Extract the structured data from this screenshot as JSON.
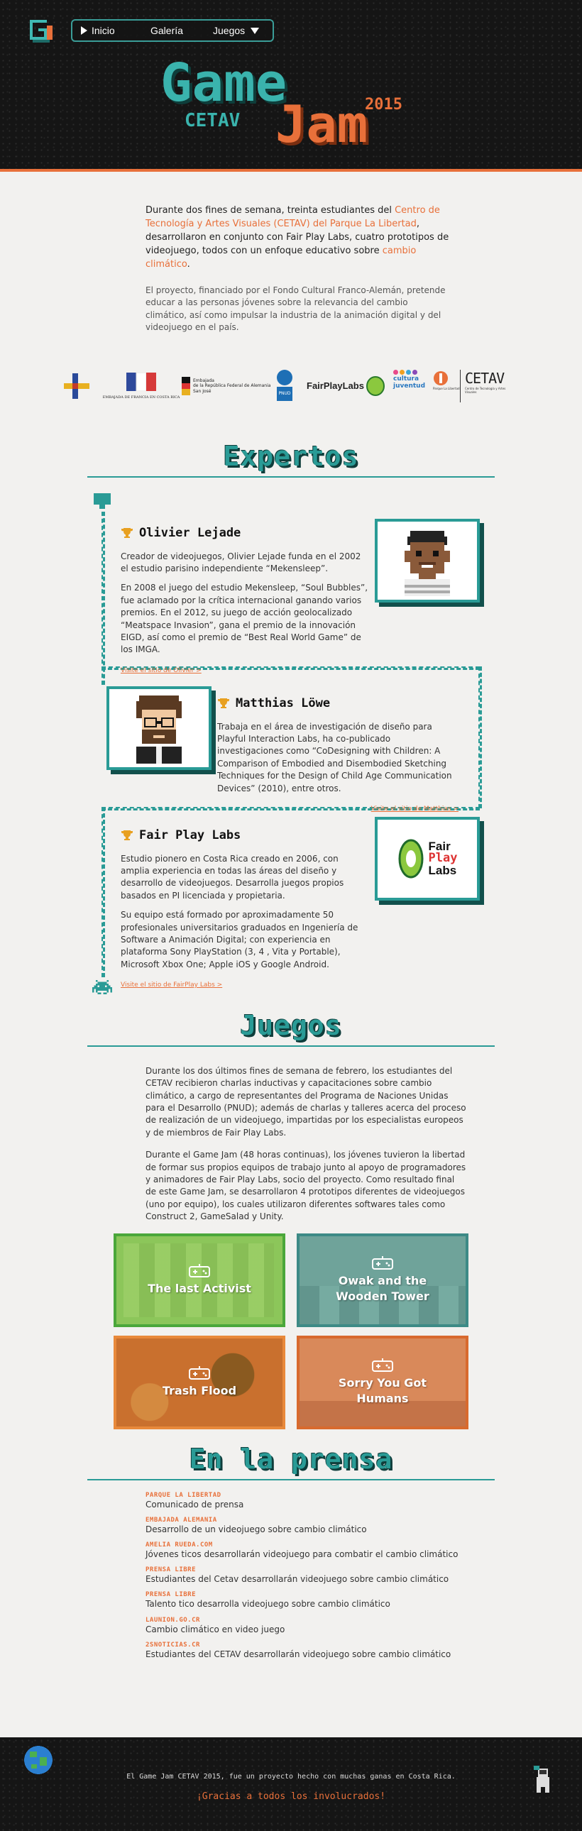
{
  "nav": {
    "items": [
      {
        "label": "Inicio",
        "icon": "play-arrow-icon"
      },
      {
        "label": "Galería"
      },
      {
        "label": "Juegos",
        "icon": "chevron-down-icon"
      }
    ]
  },
  "hero": {
    "word1": "Game",
    "word2": "CETAV",
    "word3": "Jam",
    "year": "2015"
  },
  "intro": {
    "lead_pre": "Durante dos fines de semana, treinta estudiantes del ",
    "lead_link1": "Centro de Tecnología y Artes Visuales (CETAV) del Parque La Libertad",
    "lead_mid": ", desarrollaron en conjunto con Fair Play Labs, cuatro prototipos de videojuego, todos con un enfoque educativo sobre ",
    "lead_link2": "cambio climático",
    "lead_end": ".",
    "body": "El proyecto, financiado por el Fondo Cultural Franco-Alemán, pretende educar a las personas jóvenes sobre la relevancia del cambio climático, así como impulsar la industria de la animación digital y del videojuego en el país."
  },
  "logos": {
    "france": "EMBAJADA DE FRANCIA EN COSTA RICA",
    "germany_1": "Embajada",
    "germany_2": "de la República Federal de Alemania",
    "germany_3": "San José",
    "undp": "PNUD",
    "fairplay": "FairPlayLabs",
    "cultura": "cultura juventud",
    "libertad": "Parque La Libertad",
    "cetav": "CETAV",
    "cetav_sub": "Centro de Tecnología y Artes Visuales"
  },
  "experts": {
    "title": "Expertos",
    "people": [
      {
        "name": "Olivier Lejade",
        "p1": "Creador de videojuegos, Olivier Lejade funda en el 2002 el estudio parisino independiente “Mekensleep”.",
        "p2": "En 2008 el juego del estudio Mekensleep, “Soul Bubbles”, fue aclamado por la crítica internacional ganando varios premios. En el 2012, su juego de acción geolocalizado “Meatspace Invasion”, gana el premio de la innovación EIGD, así como el premio de “Best Real World Game” de los IMGA.",
        "link": "Visite el sitio de Olivier >"
      },
      {
        "name": "Matthias Löwe",
        "p1": "Trabaja en el área de investigación de diseño para Playful Interaction Labs, ha co-publicado investigaciones como “CoDesigning with Children: A Comparison of Embodied and Disembodied Sketching Techniques for the Design of Child Age Communication Devices” (2010), entre otros.",
        "link": "Visite el sitio de Matthias >"
      },
      {
        "name": "Fair Play Labs",
        "p1": "Estudio pionero en Costa Rica creado en 2006, con amplia experiencia en todas las áreas del diseño y desarrollo de videojuegos. Desarrolla juegos propios basados en PI licenciada y propietaria.",
        "p2": "Su equipo está formado por aproximadamente 50 profesionales universitarios graduados en Ingeniería de Software a Animación Digital; con experiencia en plataforma Sony PlayStation (3, 4 , Vita y Portable), Microsoft Xbox One; Apple iOS y Google Android.",
        "link": "Visite el sitio de FairPlay Labs >",
        "logo_1": "Fair",
        "logo_2": "Play",
        "logo_3": "Labs"
      }
    ]
  },
  "games": {
    "title": "Juegos",
    "p1": "Durante los dos últimos fines de semana de febrero, los estudiantes del CETAV recibieron charlas inductivas y capacitaciones sobre cambio climático, a cargo de representantes del Programa de Naciones Unidas para el Desarrollo (PNUD); además de charlas y talleres acerca del proceso de realización de un videojuego, impartidas por los especialistas europeos y de miembros de Fair Play Labs.",
    "p2": "Durante el Game Jam (48 horas continuas), los jóvenes tuvieron la libertad de formar sus propios equipos de trabajo junto al apoyo de programadores y animadores de Fair Play Labs, socio del proyecto. Como resultado final de este Game Jam, se desarrollaron 4 prototipos diferentes de videojuegos (uno por equipo), los cuales utilizaron diferentes softwares tales como Construct 2, GameSalad y Unity.",
    "tiles": [
      {
        "label": "The last Activist",
        "color": "#5cb84a"
      },
      {
        "label": "Owak and the Wooden Tower",
        "color": "#3d8a86"
      },
      {
        "label": "Trash Flood",
        "color": "#e8893a"
      },
      {
        "label": "Sorry You Got Humans",
        "color": "#d86a2e"
      }
    ]
  },
  "press": {
    "title": "En la prensa",
    "items": [
      {
        "source": "Parque La Libertad",
        "title": "Comunicado de prensa"
      },
      {
        "source": "Embajada Alemania",
        "title": "Desarrollo de un videojuego sobre cambio climático"
      },
      {
        "source": "amelia rueda.com",
        "title": "Jóvenes ticos desarrollarán videojuego para combatir el cambio climático"
      },
      {
        "source": "Prensa Libre",
        "title": "Estudiantes del Cetav desarrollarán videojuego sobre cambio climático"
      },
      {
        "source": "Prensa Libre",
        "title": "Talento tico desarrolla videojuego sobre cambio climático"
      },
      {
        "source": "Launion.go.cr",
        "title": "Cambio climático en video juego"
      },
      {
        "source": "2snoticias.cr",
        "title": "Estudiantes del CETAV desarrollarán videojuego sobre cambio climático"
      }
    ]
  },
  "footer": {
    "line1": "El Game Jam CETAV 2015, fue un proyecto hecho con muchas ganas en Costa Rica.",
    "line2": "¡Gracias a todos los involucrados!"
  }
}
